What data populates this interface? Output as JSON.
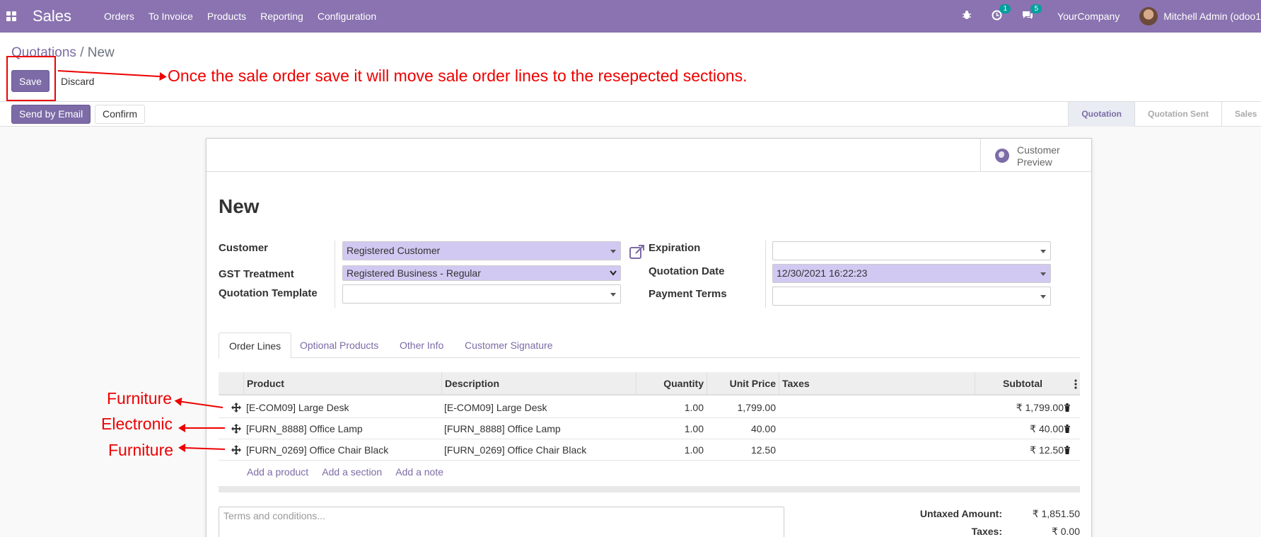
{
  "navbar": {
    "app_name": "Sales",
    "menu": [
      "Orders",
      "To Invoice",
      "Products",
      "Reporting",
      "Configuration"
    ],
    "activity_badge": "1",
    "messages_badge": "5",
    "company": "YourCompany",
    "user": "Mitchell Admin (odoo1"
  },
  "breadcrumb": {
    "parent": "Quotations",
    "separator": "/",
    "current": "New"
  },
  "buttons": {
    "save": "Save",
    "discard": "Discard",
    "send_email": "Send by Email",
    "confirm": "Confirm"
  },
  "annotations": {
    "save_note": "Once the sale order save it will move sale order lines to the resepected sections.",
    "row1": "Furniture",
    "row2": "Electronic",
    "row3": "Furniture"
  },
  "stages": [
    "Quotation",
    "Quotation Sent",
    "Sales"
  ],
  "active_stage": "Quotation",
  "preview": {
    "line1": "Customer",
    "line2": "Preview"
  },
  "form": {
    "title": "New",
    "customer_label": "Customer",
    "customer_value": "Registered Customer",
    "gst_label": "GST Treatment",
    "gst_value": "Registered Business - Regular",
    "template_label": "Quotation Template",
    "template_value": "",
    "expiration_label": "Expiration",
    "expiration_value": "",
    "quotation_date_label": "Quotation Date",
    "quotation_date_value": "12/30/2021 16:22:23",
    "payment_terms_label": "Payment Terms",
    "payment_terms_value": ""
  },
  "tabs": [
    "Order Lines",
    "Optional Products",
    "Other Info",
    "Customer Signature"
  ],
  "table": {
    "headers": {
      "product": "Product",
      "description": "Description",
      "quantity": "Quantity",
      "unit_price": "Unit Price",
      "taxes": "Taxes",
      "subtotal": "Subtotal"
    },
    "rows": [
      {
        "product": "[E-COM09] Large Desk",
        "description": "[E-COM09] Large Desk",
        "quantity": "1.00",
        "unit_price": "1,799.00",
        "taxes": "",
        "subtotal": "₹ 1,799.00"
      },
      {
        "product": "[FURN_8888] Office Lamp",
        "description": "[FURN_8888] Office Lamp",
        "quantity": "1.00",
        "unit_price": "40.00",
        "taxes": "",
        "subtotal": "₹ 40.00"
      },
      {
        "product": "[FURN_0269] Office Chair Black",
        "description": "[FURN_0269] Office Chair Black",
        "quantity": "1.00",
        "unit_price": "12.50",
        "taxes": "",
        "subtotal": "₹ 12.50"
      }
    ],
    "add_product": "Add a product",
    "add_section": "Add a section",
    "add_note": "Add a note"
  },
  "terms_placeholder": "Terms and conditions...",
  "totals": {
    "untaxed_label": "Untaxed Amount:",
    "untaxed_value": "₹ 1,851.50",
    "taxes_label": "Taxes:",
    "taxes_value": "₹ 0.00"
  },
  "colors": {
    "navbar": "#8a73b0",
    "primary": "#7c6ba6",
    "required_field": "#d2c9f2",
    "annotation": "#ee0000"
  }
}
